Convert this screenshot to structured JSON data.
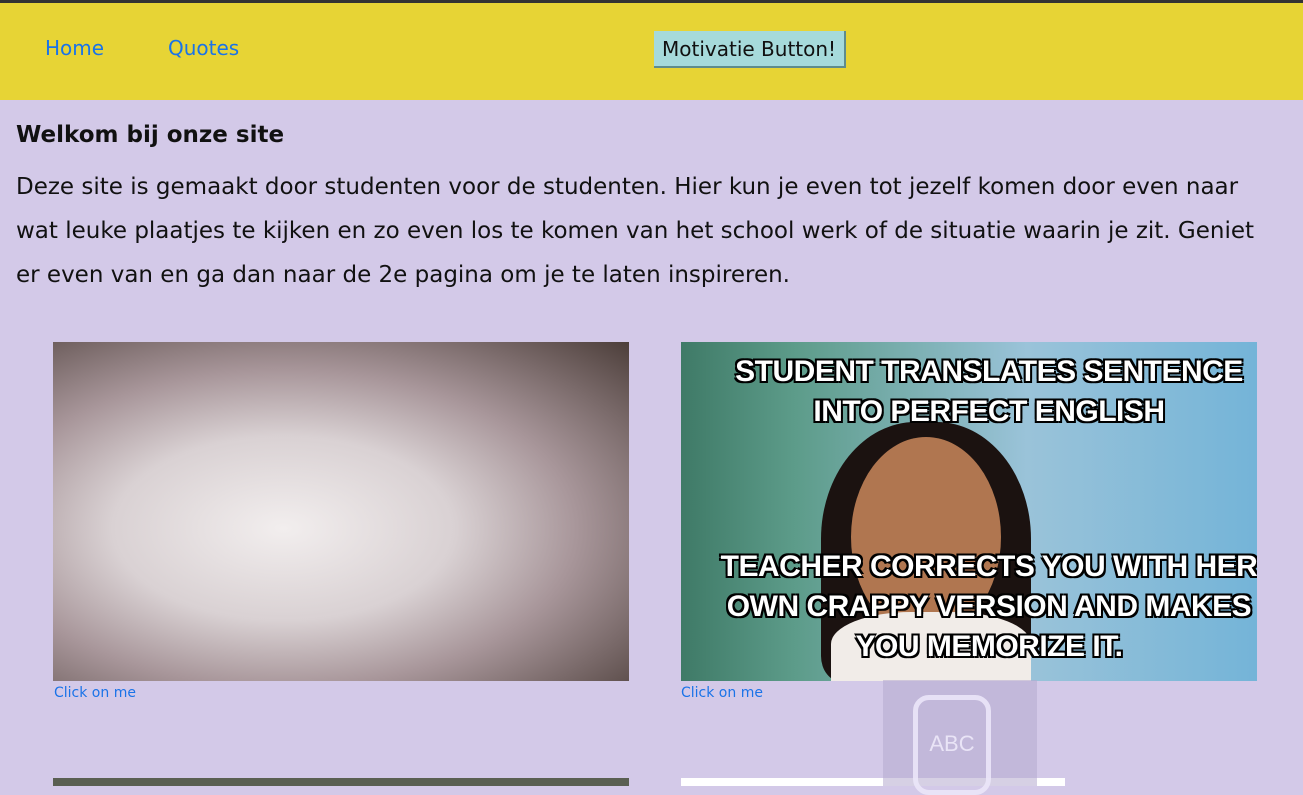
{
  "nav": {
    "home": "Home",
    "quotes": "Quotes",
    "button": "Motivatie Button!"
  },
  "main": {
    "title": "Welkom bij onze site",
    "intro": "Deze site is gemaakt door studenten voor de studenten. Hier kun je even tot jezelf komen door even naar wat leuke plaatjes te kijken en zo even los te komen van het school werk of de situatie waarin je zit. Geniet er even van en ga dan naar de 2e pagina om je te laten inspireren.",
    "images": [
      {
        "link": "Click on me"
      },
      {
        "caption_top": "STUDENT TRANSLATES SENTENCE INTO PERFECT ENGLISH",
        "caption_bottom": "TEACHER CORRECTS YOU WITH HER OWN CRAPPY VERSION AND MAKES YOU MEMORIZE IT.",
        "link": "Click on me"
      }
    ]
  },
  "overlay": {
    "keyboard_label": "ABC"
  }
}
